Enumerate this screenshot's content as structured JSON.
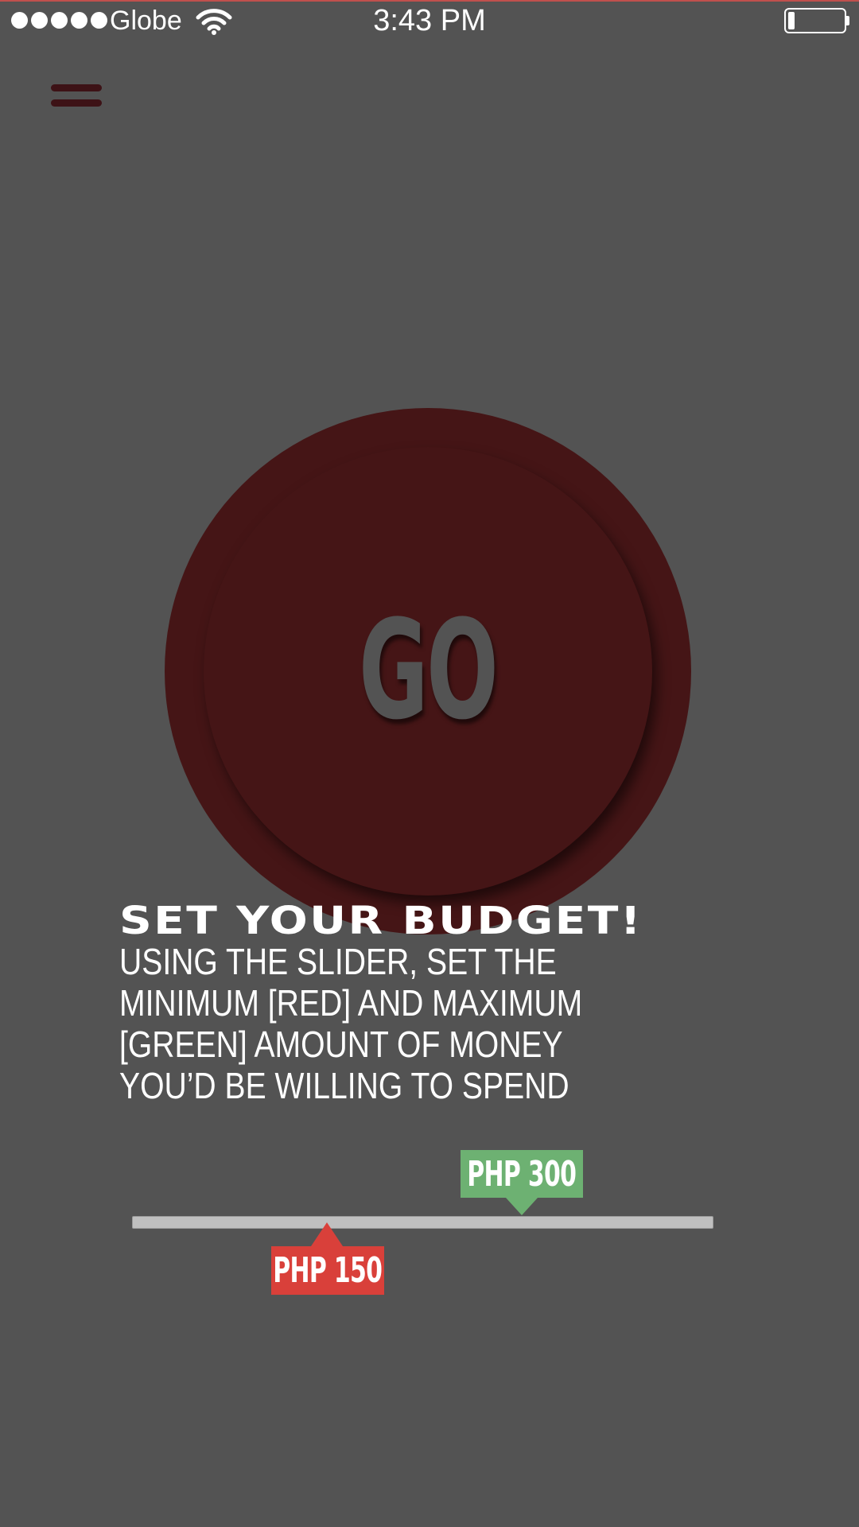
{
  "status_bar": {
    "carrier": "Globe",
    "time": "3:43 PM",
    "signal_bars": 5,
    "battery_level": 0.12,
    "icons": [
      "signal-dots-icon",
      "wifi-icon",
      "battery-icon"
    ]
  },
  "menu": {
    "icon": "hamburger-menu-icon"
  },
  "go_button": {
    "label": "GO"
  },
  "instructions": {
    "heading": "SET YOUR BUDGET!",
    "lines": [
      "USING THE SLIDER, SET THE",
      "MINIMUM [RED] AND MAXIMUM",
      "[GREEN] AMOUNT OF MONEY",
      "YOU’D BE WILLING TO SPEND"
    ]
  },
  "budget_slider": {
    "min_label": "PHP 150",
    "max_label": "PHP 300",
    "min_position": 0.335,
    "max_position": 0.67,
    "min_color": "#d9403a",
    "max_color": "#6db172"
  },
  "colors": {
    "background": "#535353",
    "go_button": "#451516",
    "menu_icon": "#3d1216",
    "track": "#bfbfbf"
  }
}
